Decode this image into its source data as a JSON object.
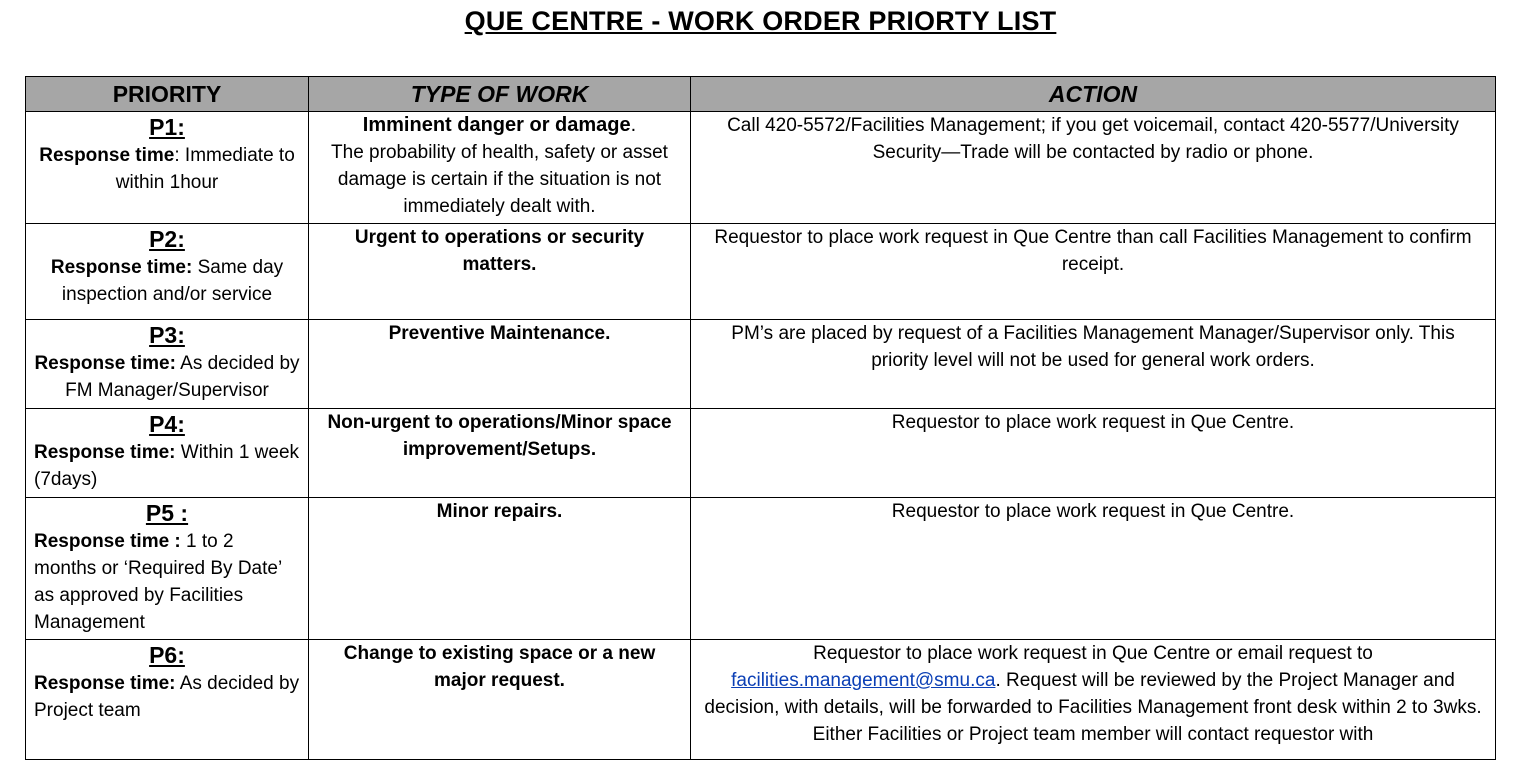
{
  "title": "QUE CENTRE - WORK ORDER PRIORTY LIST",
  "headers": {
    "priority": "PRIORITY",
    "type": "TYPE OF WORK",
    "action": "ACTION"
  },
  "rows": [
    {
      "code": "P1:",
      "rt_label": "Response time",
      "rt_value": ": Immediate to within 1hour",
      "type_head": "Imminent danger or damage",
      "type_tail": ".",
      "type_body": "The probability of health, safety or asset damage is certain if the situation is not immediately dealt with.",
      "action": "Call 420-5572/Facilities Management; if you get voicemail, contact 420-5577/University Security—Trade will be contacted by radio or phone."
    },
    {
      "code": "P2:",
      "rt_label": "Response time:",
      "rt_value": " Same day inspection and/or service",
      "type_head": "Urgent to operations or security matters.",
      "action": "Requestor to place work request in Que Centre than call Facilities Management to confirm receipt."
    },
    {
      "code": "P3:",
      "rt_label": "Response time:",
      "rt_value": " As decided by FM Manager/Supervisor",
      "type_head": "Preventive Maintenance.",
      "action": "PM’s are placed by request of a Facilities Management Manager/Supervisor only. This priority level will not be used for general work orders."
    },
    {
      "code": "P4:",
      "rt_label": "Response time:",
      "rt_value": " Within 1 week (7days)",
      "type_head": "Non-urgent to operations/Minor space improvement/Setups.",
      "action": "Requestor to place work request in Que Centre."
    },
    {
      "code": "P5 :",
      "rt_label": "Response time :",
      "rt_value": " 1 to 2 months or ‘Required By Date’ as approved by Facilities Management",
      "type_head": "Minor repairs.",
      "action": "Requestor to place work request in Que Centre."
    },
    {
      "code": "P6:",
      "rt_label": "Response time:",
      "rt_value": " As decided by Project team",
      "type_head": "Change to existing space or a new major request.",
      "action_pre": "Requestor to place work request in Que Centre or email request to ",
      "action_link": "facilities.management@smu.ca",
      "action_post": ". Request will be reviewed by the Project Manager and decision, with details, will be forwarded to Facilities Management front desk within 2 to 3wks. Either Facilities or Project team member will contact requestor with"
    }
  ]
}
